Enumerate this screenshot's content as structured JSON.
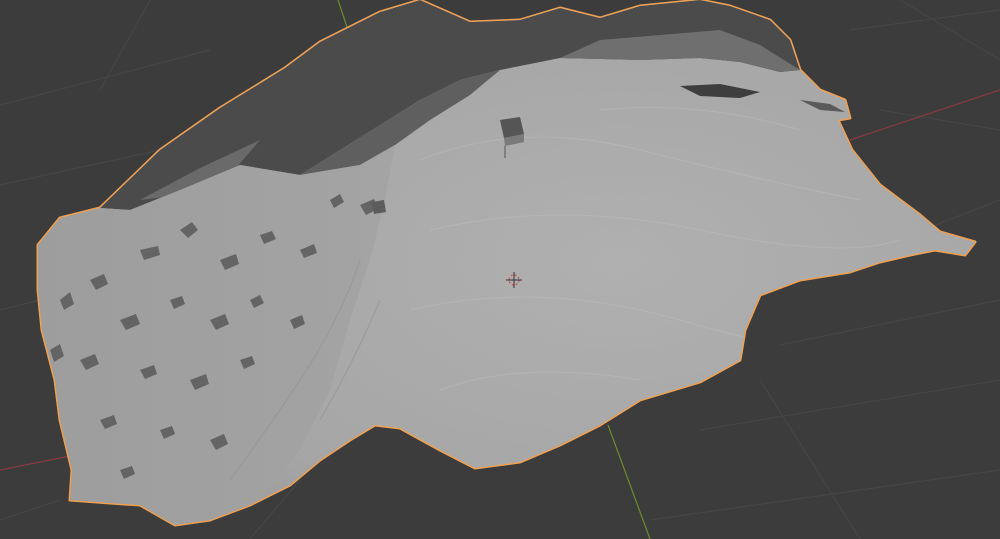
{
  "viewport": {
    "mode": "object-mode",
    "background_color": "#3c3c3c",
    "grid_color": "#4a4a4a",
    "x_axis_color": "#8a3a42",
    "y_axis_color": "#6f8a2e",
    "selection_outline_color": "#f0a050",
    "mesh_base_color": "#a9a9a9",
    "mesh_shadow_color": "#444444"
  },
  "scene": {
    "selected_object": "terrain-scan-mesh",
    "cursor_icon": "3d-cursor-icon"
  }
}
